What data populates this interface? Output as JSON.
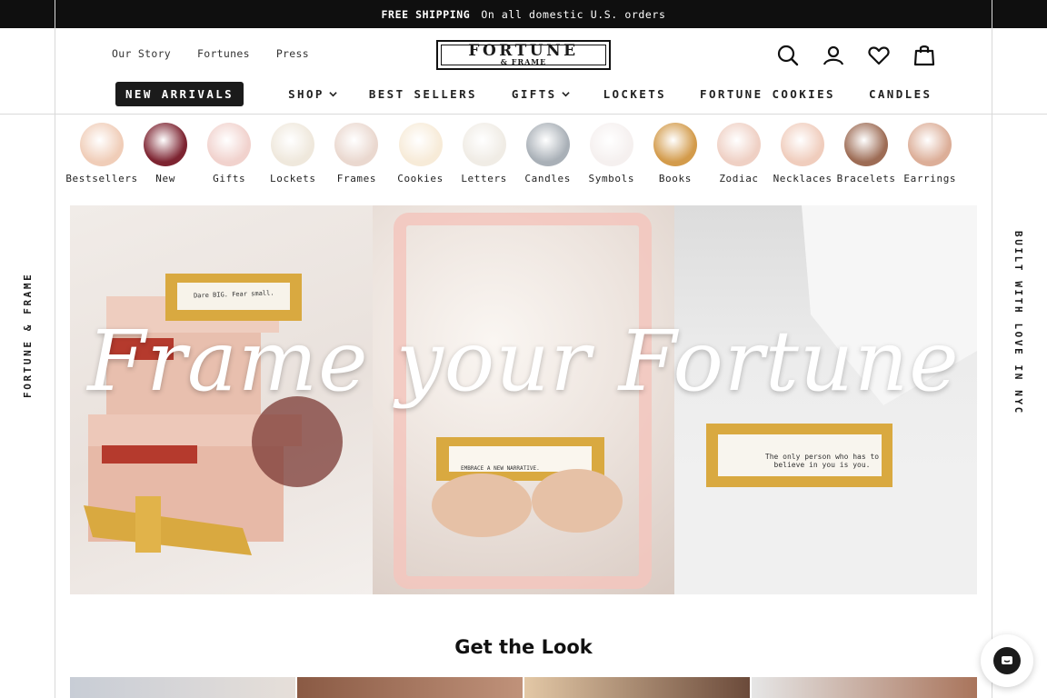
{
  "announcement": {
    "bold": "FREE SHIPPING",
    "text": "On all domestic U.S. orders"
  },
  "top_links": [
    "Our Story",
    "Fortunes",
    "Press"
  ],
  "logo": {
    "line1": "FORTUNE",
    "line2": "& FRAME"
  },
  "utility_icons": [
    "search-icon",
    "account-icon",
    "heart-icon",
    "bag-icon"
  ],
  "main_nav": [
    {
      "label": "NEW ARRIVALS",
      "active": true
    },
    {
      "label": "SHOP",
      "dropdown": true
    },
    {
      "label": "BEST SELLERS"
    },
    {
      "label": "GIFTS",
      "dropdown": true
    },
    {
      "label": "LOCKETS"
    },
    {
      "label": "FORTUNE COOKIES"
    },
    {
      "label": "CANDLES"
    }
  ],
  "categories": [
    {
      "label": "Bestsellers",
      "color": "#f0cdb8"
    },
    {
      "label": "New",
      "color": "#7d2431"
    },
    {
      "label": "Gifts",
      "color": "#f1d2cd"
    },
    {
      "label": "Lockets",
      "color": "#efe8dc"
    },
    {
      "label": "Frames",
      "color": "#ead8cf"
    },
    {
      "label": "Cookies",
      "color": "#f7ebd8"
    },
    {
      "label": "Letters",
      "color": "#f0ece5"
    },
    {
      "label": "Candles",
      "color": "#a9b0b7"
    },
    {
      "label": "Symbols",
      "color": "#f5f0ef"
    },
    {
      "label": "Books",
      "color": "#d39b4b"
    },
    {
      "label": "Zodiac",
      "color": "#efd0c4"
    },
    {
      "label": "Necklaces",
      "color": "#f0cdbd"
    },
    {
      "label": "Bracelets",
      "color": "#9d6c55"
    },
    {
      "label": "Earrings",
      "color": "#dcae98"
    }
  ],
  "hero": {
    "title": "Frame your Fortune",
    "slip1": "Dare BIG. Fear small.",
    "slip2": "EMBRACE A NEW NARRATIVE.",
    "slip3": "The only person who has to believe in you is you."
  },
  "side_left": "FORTUNE & FRAME",
  "side_right": "BUILT WITH LOVE IN NYC",
  "section_title": "Get the Look"
}
